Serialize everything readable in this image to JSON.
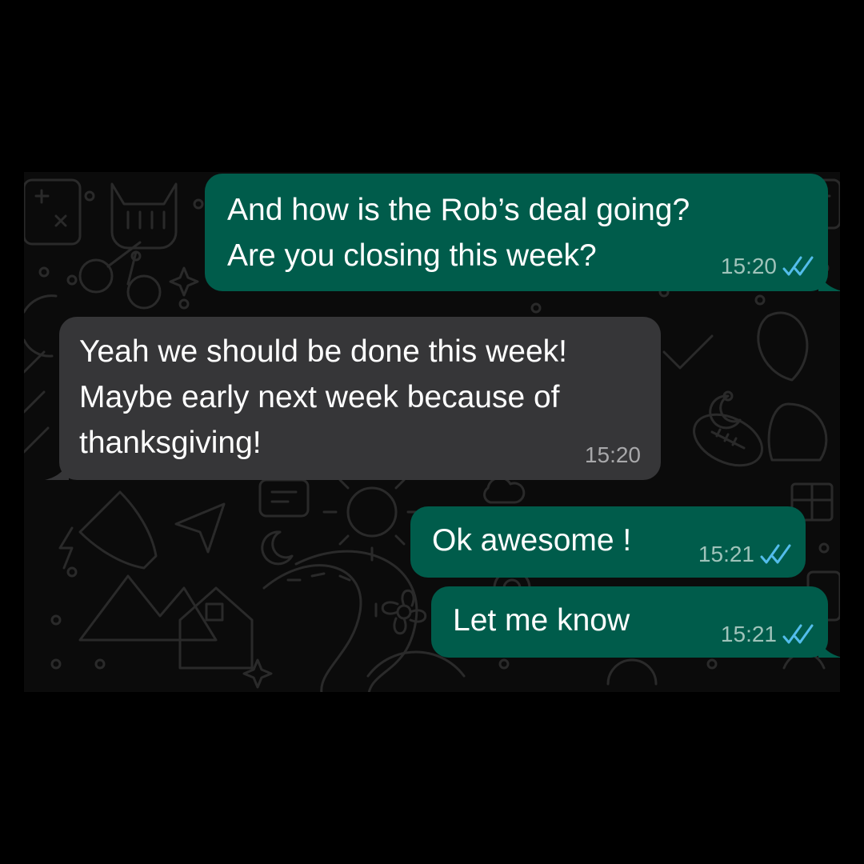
{
  "messages": [
    {
      "direction": "outgoing",
      "lines": [
        "And how is the Rob’s deal going?",
        "Are you closing this week?"
      ],
      "time": "15:20",
      "status_icon": "double-check-read-icon"
    },
    {
      "direction": "incoming",
      "lines": [
        "Yeah we should be done this week!",
        "Maybe early next week because of",
        "thanksgiving!"
      ],
      "time": "15:20"
    },
    {
      "direction": "outgoing",
      "lines": [
        "Ok awesome !"
      ],
      "time": "15:21",
      "status_icon": "double-check-read-icon"
    },
    {
      "direction": "outgoing",
      "lines": [
        "Let me know"
      ],
      "time": "15:21",
      "status_icon": "double-check-read-icon"
    }
  ],
  "colors": {
    "outgoing_bubble": "#005c4b",
    "incoming_bubble": "#363638",
    "read_ticks": "#53bdeb",
    "wallpaper": "#0b0b0b"
  }
}
